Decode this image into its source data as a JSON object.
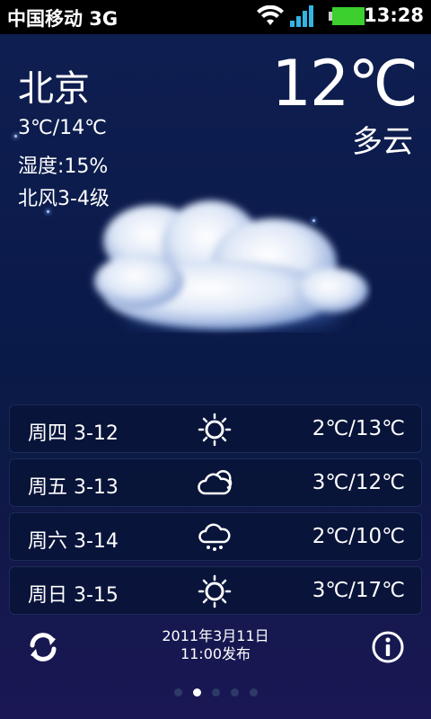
{
  "status_bar": {
    "carrier": "中国移动 3G",
    "time": "13:28"
  },
  "current": {
    "city": "北京",
    "temperature": "12℃",
    "condition": "多云",
    "range": "3℃/14℃",
    "humidity": "湿度:15%",
    "wind": "北风3-4级",
    "illustration": "cloud-icon"
  },
  "forecast": [
    {
      "day": "周四 3-12",
      "icon": "sun-icon",
      "temp": "2℃/13℃"
    },
    {
      "day": "周五 3-13",
      "icon": "cloud-icon",
      "temp": "3℃/12℃"
    },
    {
      "day": "周六 3-14",
      "icon": "snow-icon",
      "temp": "2℃/10℃"
    },
    {
      "day": "周日 3-15",
      "icon": "sun-icon",
      "temp": "3℃/17℃"
    }
  ],
  "footer": {
    "publish_date": "2011年3月11日",
    "publish_time": "11:00发布",
    "refresh_icon": "refresh-icon",
    "info_icon": "info-icon"
  },
  "pager": {
    "pages": 5,
    "active": 2
  },
  "colors": {
    "background_top": "#0f1e50",
    "background_bottom": "#1a1755",
    "text": "#ffffff",
    "battery": "#3ccf2e",
    "signal": "#33b5e5"
  }
}
